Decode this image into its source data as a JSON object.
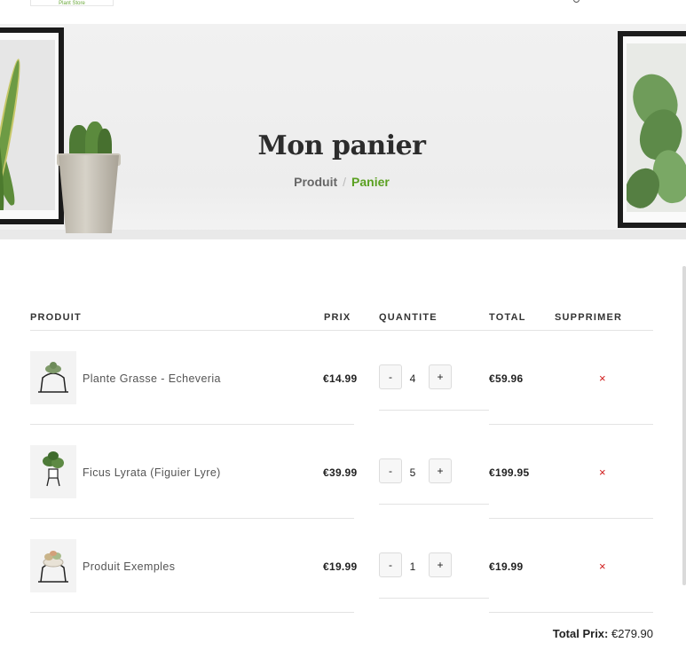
{
  "header": {
    "logo_text": "Plant Store"
  },
  "hero": {
    "title": "Mon panier",
    "breadcrumb": {
      "parent": "Produit",
      "separator": "/",
      "current": "Panier"
    }
  },
  "cart": {
    "columns": {
      "product": "PRODUIT",
      "price": "PRIX",
      "quantity": "QUANTITE",
      "total": "TOTAL",
      "remove": "SUPPRIMER"
    },
    "items": [
      {
        "name": "Plante Grasse - Echeveria",
        "price": "€14.99",
        "minus": "-",
        "quantity": "4",
        "plus": "+",
        "total": "€59.96",
        "remove": "×"
      },
      {
        "name": "Ficus Lyrata (Figuier Lyre)",
        "price": "€39.99",
        "minus": "-",
        "quantity": "5",
        "plus": "+",
        "total": "€199.95",
        "remove": "×"
      },
      {
        "name": "Produit Exemples",
        "price": "€19.99",
        "minus": "-",
        "quantity": "1",
        "plus": "+",
        "total": "€19.99",
        "remove": "×"
      }
    ],
    "grand_total": {
      "label": "Total Prix:",
      "value": "€279.90"
    }
  },
  "colors": {
    "accent": "#5aa021",
    "remove": "#d01818",
    "title": "#2c2c2c"
  }
}
